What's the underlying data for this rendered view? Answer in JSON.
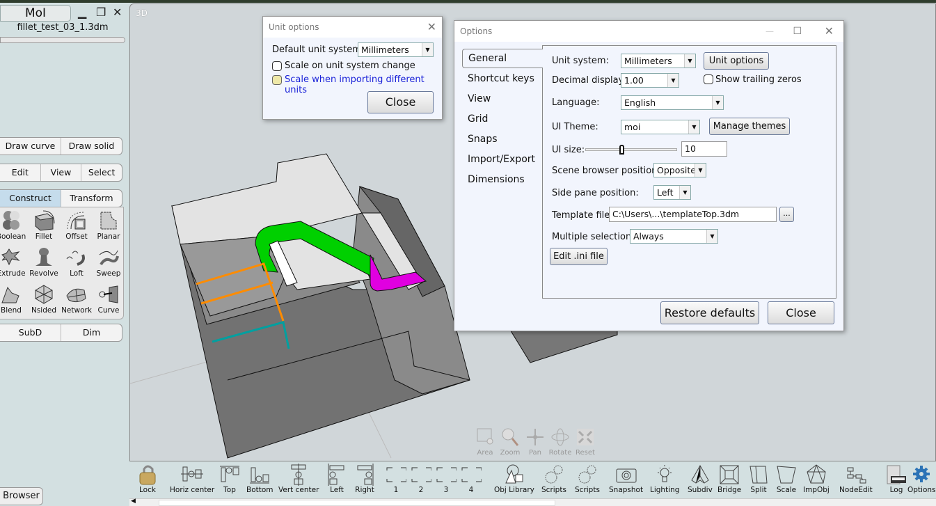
{
  "app": {
    "title": "MoI",
    "filename": "fillet_test_03_1.3dm",
    "window_controls": [
      "minimize-icon",
      "restore-icon",
      "close-icon"
    ]
  },
  "left_panel": {
    "tab_row_1": [
      "Draw curve",
      "Draw solid"
    ],
    "tab_row_2": [
      "Edit",
      "View",
      "Select"
    ],
    "tab_row_3": {
      "items": [
        "Construct",
        "Transform"
      ],
      "active": "Construct"
    },
    "commands": [
      {
        "label": "Boolean",
        "icon": "boolean-icon"
      },
      {
        "label": "Fillet",
        "icon": "fillet-icon"
      },
      {
        "label": "Offset",
        "icon": "offset-icon"
      },
      {
        "label": "Planar",
        "icon": "planar-icon"
      },
      {
        "label": "Extrude",
        "icon": "extrude-icon"
      },
      {
        "label": "Revolve",
        "icon": "revolve-icon"
      },
      {
        "label": "Loft",
        "icon": "loft-icon"
      },
      {
        "label": "Sweep",
        "icon": "sweep-icon"
      },
      {
        "label": "Blend",
        "icon": "blend-icon"
      },
      {
        "label": "Nsided",
        "icon": "nsided-icon"
      },
      {
        "label": "Network",
        "icon": "network-icon"
      },
      {
        "label": "Curve",
        "icon": "curve-icon"
      }
    ],
    "tab_row_4": [
      "SubD",
      "Dim"
    ],
    "browser_label": "Browser"
  },
  "viewport": {
    "label": "3D",
    "nav_controls": [
      "Area",
      "Zoom",
      "Pan",
      "Rotate",
      "Reset"
    ],
    "model_colors": {
      "fillet_green": "#00d000",
      "fillet_magenta": "#e000e0",
      "edge_orange": "#ff8c00",
      "edge_teal": "#00a0a0"
    }
  },
  "bottom_toolbar": {
    "tools": [
      {
        "label": "Lock",
        "icon": "lock-icon"
      },
      {
        "label": "Horiz center",
        "icon": "align-horiz-center-icon"
      },
      {
        "label": "Top",
        "icon": "align-top-icon"
      },
      {
        "label": "Bottom",
        "icon": "align-bottom-icon"
      },
      {
        "label": "Vert center",
        "icon": "align-vert-center-icon"
      },
      {
        "label": "Left",
        "icon": "align-left-icon"
      },
      {
        "label": "Right",
        "icon": "align-right-icon"
      },
      {
        "label": "1",
        "icon": "view-1-icon"
      },
      {
        "label": "2",
        "icon": "view-2-icon"
      },
      {
        "label": "3",
        "icon": "view-3-icon"
      },
      {
        "label": "4",
        "icon": "view-4-icon"
      },
      {
        "label": "Obj Library",
        "icon": "obj-library-icon"
      },
      {
        "label": "Scripts",
        "icon": "gears-icon"
      },
      {
        "label": "Scripts",
        "icon": "gears-icon"
      },
      {
        "label": "Snapshot",
        "icon": "camera-icon"
      },
      {
        "label": "Lighting",
        "icon": "lightbulb-icon"
      },
      {
        "label": "Subdiv",
        "icon": "subdiv-icon"
      },
      {
        "label": "Bridge",
        "icon": "bridge-icon"
      },
      {
        "label": "Split",
        "icon": "split-icon"
      },
      {
        "label": "Scale",
        "icon": "scale-icon"
      },
      {
        "label": "ImpObj",
        "icon": "impobj-icon"
      },
      {
        "label": "NodeEdit",
        "icon": "nodeedit-icon"
      },
      {
        "label": "Log",
        "icon": "log-icon"
      },
      {
        "label": "Options",
        "icon": "gear-icon"
      }
    ]
  },
  "unit_options_dialog": {
    "title": "Unit options",
    "default_unit_label": "Default unit system:",
    "default_unit_value": "Millimeters",
    "scale_on_change_label": "Scale on unit system change",
    "scale_on_change_checked": false,
    "scale_importing_label": "Scale when importing different units",
    "scale_importing_checked": false,
    "close_label": "Close"
  },
  "options_dialog": {
    "title": "Options",
    "nav": [
      "General",
      "Shortcut keys",
      "View",
      "Grid",
      "Snaps",
      "Import/Export",
      "Dimensions"
    ],
    "active_nav": "General",
    "general": {
      "unit_system_label": "Unit system:",
      "unit_system_value": "Millimeters",
      "unit_options_button": "Unit options",
      "decimal_display_label": "Decimal display:",
      "decimal_display_value": "1.00",
      "show_trailing_zeros_label": "Show trailing zeros",
      "show_trailing_zeros_checked": false,
      "language_label": "Language:",
      "language_value": "English",
      "ui_theme_label": "UI Theme:",
      "ui_theme_value": "moi",
      "manage_themes_button": "Manage themes",
      "ui_size_label": "UI size:",
      "ui_size_value": "10",
      "ui_size_slider_fraction": 0.4,
      "scene_browser_label": "Scene browser position:",
      "scene_browser_value": "Opposite",
      "side_pane_label": "Side pane position:",
      "side_pane_value": "Left",
      "template_file_label": "Template file:",
      "template_file_value": "C:\\Users\\...\\templateTop.3dm",
      "browse_button": "...",
      "multiple_selection_label": "Multiple selection:",
      "multiple_selection_value": "Always",
      "edit_ini_button": "Edit .ini file"
    },
    "restore_defaults_button": "Restore defaults",
    "close_button": "Close"
  }
}
